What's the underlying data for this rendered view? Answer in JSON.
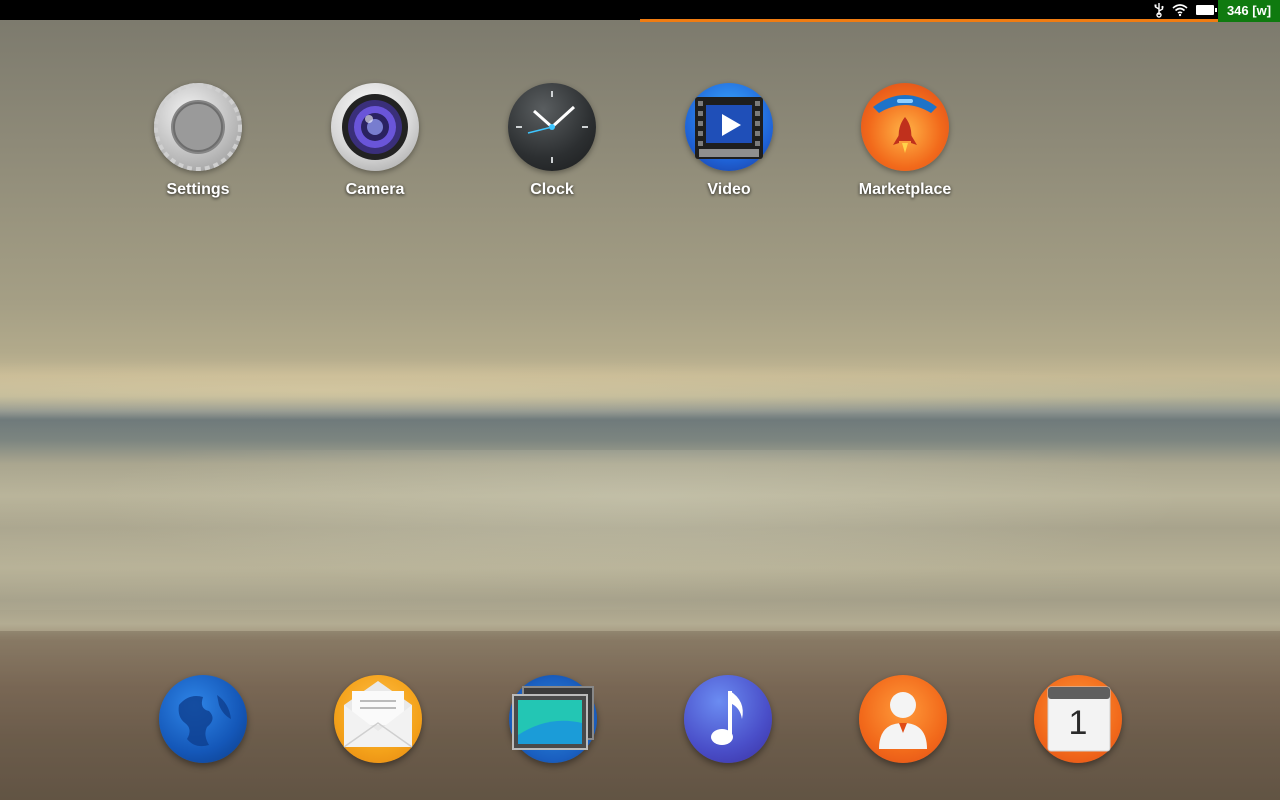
{
  "statusbar": {
    "icons": [
      "usb-icon",
      "wifi-icon",
      "battery-icon"
    ],
    "memory_badge": "346 [w]",
    "badge_color": "#0f7a0f",
    "progress_color": "#f07c12"
  },
  "home": {
    "apps": [
      {
        "label": "Settings",
        "icon": "settings-gear-icon"
      },
      {
        "label": "Camera",
        "icon": "camera-lens-icon"
      },
      {
        "label": "Clock",
        "icon": "clock-icon"
      },
      {
        "label": "Video",
        "icon": "video-play-icon"
      },
      {
        "label": "Marketplace",
        "icon": "marketplace-rocket-icon"
      }
    ]
  },
  "dock": {
    "apps": [
      {
        "icon": "browser-globe-icon"
      },
      {
        "icon": "email-envelope-icon"
      },
      {
        "icon": "gallery-icon"
      },
      {
        "icon": "music-note-icon"
      },
      {
        "icon": "contacts-person-icon"
      },
      {
        "icon": "calendar-icon",
        "text": "1"
      }
    ]
  }
}
